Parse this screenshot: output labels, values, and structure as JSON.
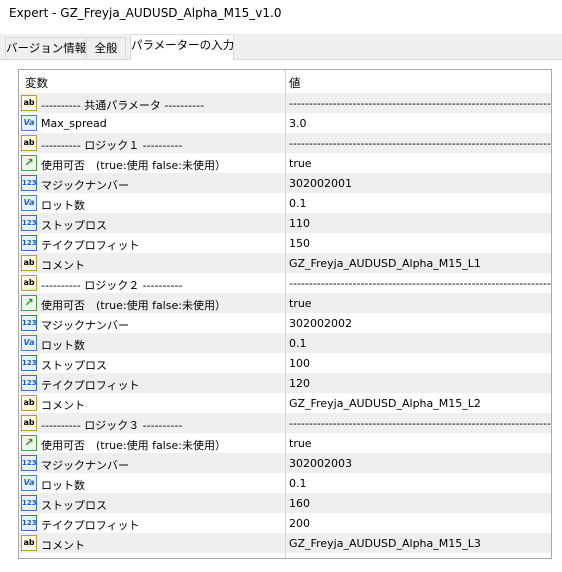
{
  "window": {
    "title": "Expert - GZ_Freyja_AUDUSD_Alpha_M15_v1.0"
  },
  "tabs": [
    {
      "label": "バージョン情報"
    },
    {
      "label": "全般"
    },
    {
      "label": "パラメーターの入力"
    }
  ],
  "grid": {
    "header": {
      "name": "変数",
      "value": "値"
    },
    "rows": [
      {
        "icon": "ab",
        "name": "----------    共通パラメータ    ----------",
        "value": "--------------------------------------------------------------------"
      },
      {
        "icon": "va",
        "name": "Max_spread",
        "value": "3.0"
      },
      {
        "icon": "ab",
        "name": "----------    ロジック１    ----------",
        "value": "--------------------------------------------------------------------"
      },
      {
        "icon": "bool",
        "name": "使用可否　(true:使用  false:未使用）",
        "value": "true"
      },
      {
        "icon": "num",
        "name": "マジックナンバー",
        "value": "302002001"
      },
      {
        "icon": "va",
        "name": "ロット数",
        "value": "0.1"
      },
      {
        "icon": "num",
        "name": "ストップロス",
        "value": "110"
      },
      {
        "icon": "num",
        "name": "テイクプロフィット",
        "value": "150"
      },
      {
        "icon": "ab",
        "name": "コメント",
        "value": "GZ_Freyja_AUDUSD_Alpha_M15_L1"
      },
      {
        "icon": "ab",
        "name": "----------    ロジック２    ----------",
        "value": "--------------------------------------------------------------------"
      },
      {
        "icon": "bool",
        "name": "使用可否　(true:使用  false:未使用）",
        "value": "true"
      },
      {
        "icon": "num",
        "name": "マジックナンバー",
        "value": "302002002"
      },
      {
        "icon": "va",
        "name": "ロット数",
        "value": "0.1"
      },
      {
        "icon": "num",
        "name": "ストップロス",
        "value": "100"
      },
      {
        "icon": "num",
        "name": "テイクプロフィット",
        "value": "120"
      },
      {
        "icon": "ab",
        "name": "コメント",
        "value": "GZ_Freyja_AUDUSD_Alpha_M15_L2"
      },
      {
        "icon": "ab",
        "name": "----------    ロジック３    ----------",
        "value": "--------------------------------------------------------------------"
      },
      {
        "icon": "bool",
        "name": "使用可否　(true:使用  false:未使用）",
        "value": "true"
      },
      {
        "icon": "num",
        "name": "マジックナンバー",
        "value": "302002003"
      },
      {
        "icon": "va",
        "name": "ロット数",
        "value": "0.1"
      },
      {
        "icon": "num",
        "name": "ストップロス",
        "value": "160"
      },
      {
        "icon": "num",
        "name": "テイクプロフィット",
        "value": "200"
      },
      {
        "icon": "ab",
        "name": "コメント",
        "value": "GZ_Freyja_AUDUSD_Alpha_M15_L3"
      }
    ]
  },
  "icon_labels": {
    "ab": "ab",
    "va": "Va",
    "num": "123",
    "bool": "↗"
  }
}
